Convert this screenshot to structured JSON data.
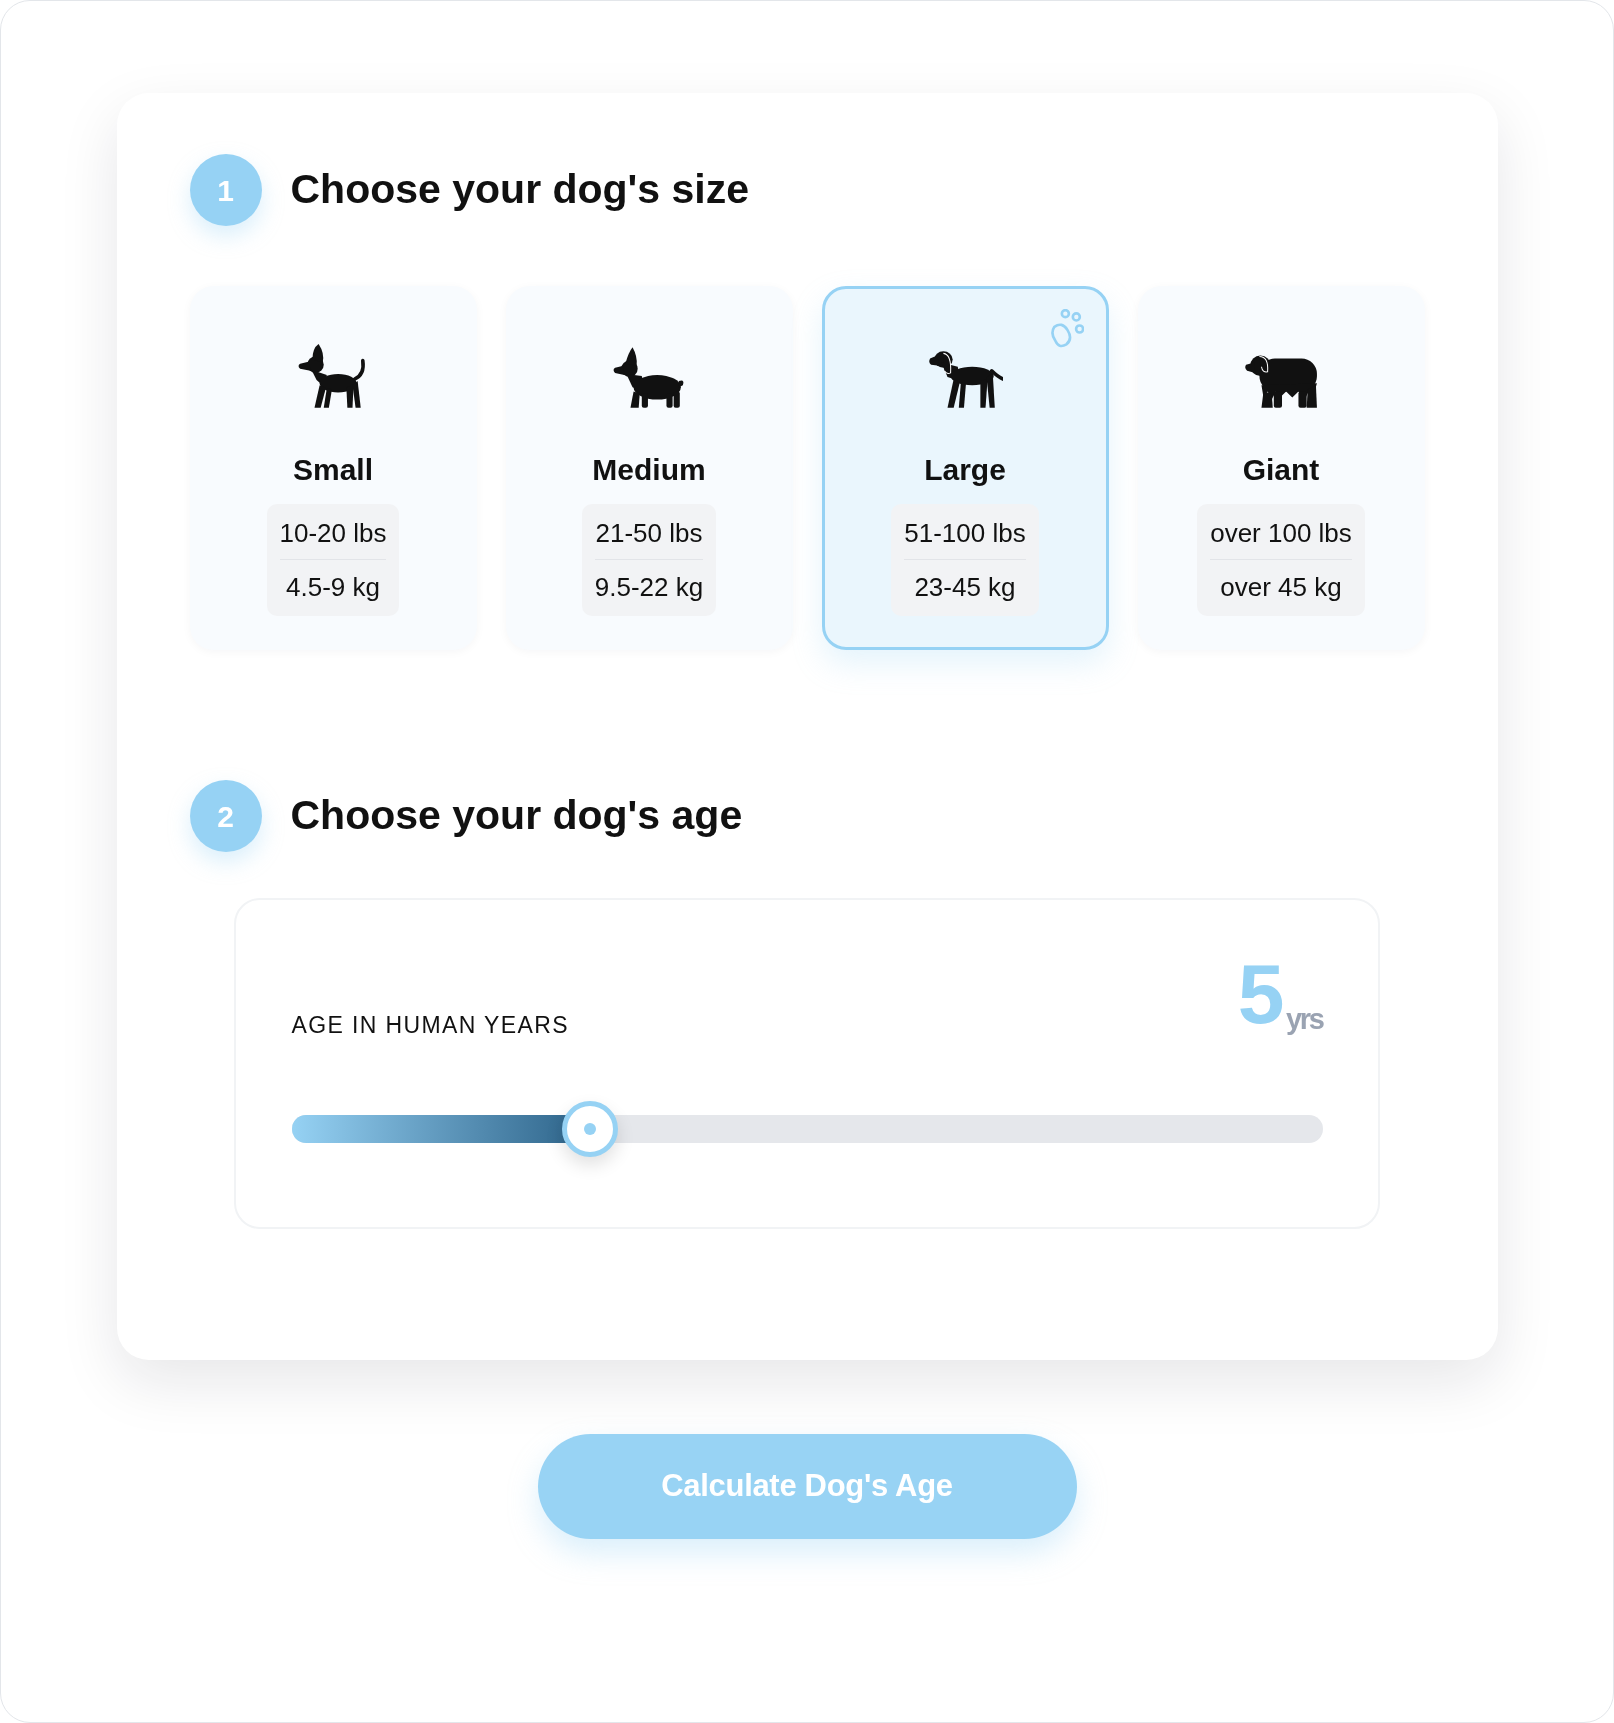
{
  "size_section": {
    "step": "1",
    "title": "Choose your dog's size",
    "options": [
      {
        "kind": "small",
        "label": "Small",
        "weight_lbs": "10-20 lbs",
        "weight_kg": "4.5-9 kg",
        "selected": false
      },
      {
        "kind": "medium",
        "label": "Medium",
        "weight_lbs": "21-50 lbs",
        "weight_kg": "9.5-22 kg",
        "selected": false
      },
      {
        "kind": "large",
        "label": "Large",
        "weight_lbs": "51-100 lbs",
        "weight_kg": "23-45 kg",
        "selected": true
      },
      {
        "kind": "giant",
        "label": "Giant",
        "weight_lbs": "over 100 lbs",
        "weight_kg": "over 45 kg",
        "selected": false
      }
    ]
  },
  "age_section": {
    "step": "2",
    "title": "Choose your dog's age",
    "slider": {
      "label": "AGE IN HUMAN YEARS",
      "value": "5",
      "unit": "yrs",
      "level": 0.29
    }
  },
  "calculate_button": {
    "label": "Calculate Dog's Age"
  }
}
